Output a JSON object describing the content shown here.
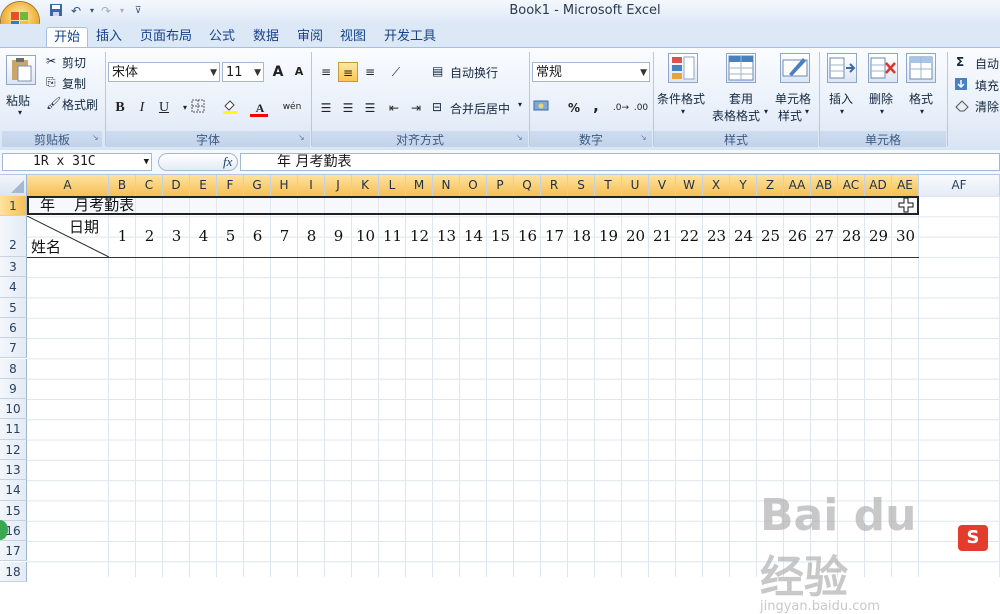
{
  "window": {
    "title": "Book1 - Microsoft Excel"
  },
  "quick_access": {
    "save_icon": "save-icon",
    "undo_icon": "undo-icon",
    "redo_icon": "redo-icon"
  },
  "tabs": [
    {
      "label": "开始",
      "active": true
    },
    {
      "label": "插入"
    },
    {
      "label": "页面布局"
    },
    {
      "label": "公式"
    },
    {
      "label": "数据"
    },
    {
      "label": "审阅"
    },
    {
      "label": "视图"
    },
    {
      "label": "开发工具"
    }
  ],
  "clipboard": {
    "paste": "粘贴",
    "cut": "剪切",
    "copy": "复制",
    "format_painter": "格式刷",
    "group": "剪贴板"
  },
  "font": {
    "name": "宋体",
    "size": "11",
    "bold": "B",
    "italic": "I",
    "underline": "U",
    "font_color_glyph": "A",
    "grow": "A",
    "shrink": "A",
    "phonetic": "wén",
    "group": "字体"
  },
  "alignment": {
    "wrap": "自动换行",
    "merge": "合并后居中",
    "group": "对齐方式"
  },
  "number": {
    "format": "常规",
    "percent": "%",
    "comma": ",",
    "group": "数字"
  },
  "styles": {
    "conditional": "条件格式",
    "table_format_1": "套用",
    "table_format_2": "表格格式",
    "cell_style_1": "单元格",
    "cell_style_2": "样式",
    "group": "样式"
  },
  "cells": {
    "insert": "插入",
    "delete": "删除",
    "format": "格式",
    "group": "单元格"
  },
  "editing": {
    "autosum": "自动",
    "fill": "填充",
    "clear": "清除"
  },
  "formula_bar": {
    "name_box": "1R x 31C",
    "fx": "fx",
    "content": "年    月考勤表"
  },
  "columns": [
    "A",
    "B",
    "C",
    "D",
    "E",
    "F",
    "G",
    "H",
    "I",
    "J",
    "K",
    "L",
    "M",
    "N",
    "O",
    "P",
    "Q",
    "R",
    "S",
    "T",
    "U",
    "V",
    "W",
    "X",
    "Y",
    "Z",
    "AA",
    "AB",
    "AC",
    "AD",
    "AE",
    "AF"
  ],
  "rows": [
    "1",
    "2",
    "3",
    "4",
    "5",
    "6",
    "7",
    "8",
    "9",
    "10",
    "11",
    "12",
    "13",
    "14",
    "15",
    "16",
    "17",
    "18"
  ],
  "sheet": {
    "title_cell": "年    月考勤表",
    "header_date": "日期",
    "header_name": "姓名",
    "days": [
      "1",
      "2",
      "3",
      "4",
      "5",
      "6",
      "7",
      "8",
      "9",
      "10",
      "11",
      "12",
      "13",
      "14",
      "15",
      "16",
      "17",
      "18",
      "19",
      "20",
      "21",
      "22",
      "23",
      "24",
      "25",
      "26",
      "27",
      "28",
      "29",
      "30"
    ]
  },
  "watermark": {
    "text": "Bai du 经验",
    "sub": "jingyan.baidu.com"
  }
}
